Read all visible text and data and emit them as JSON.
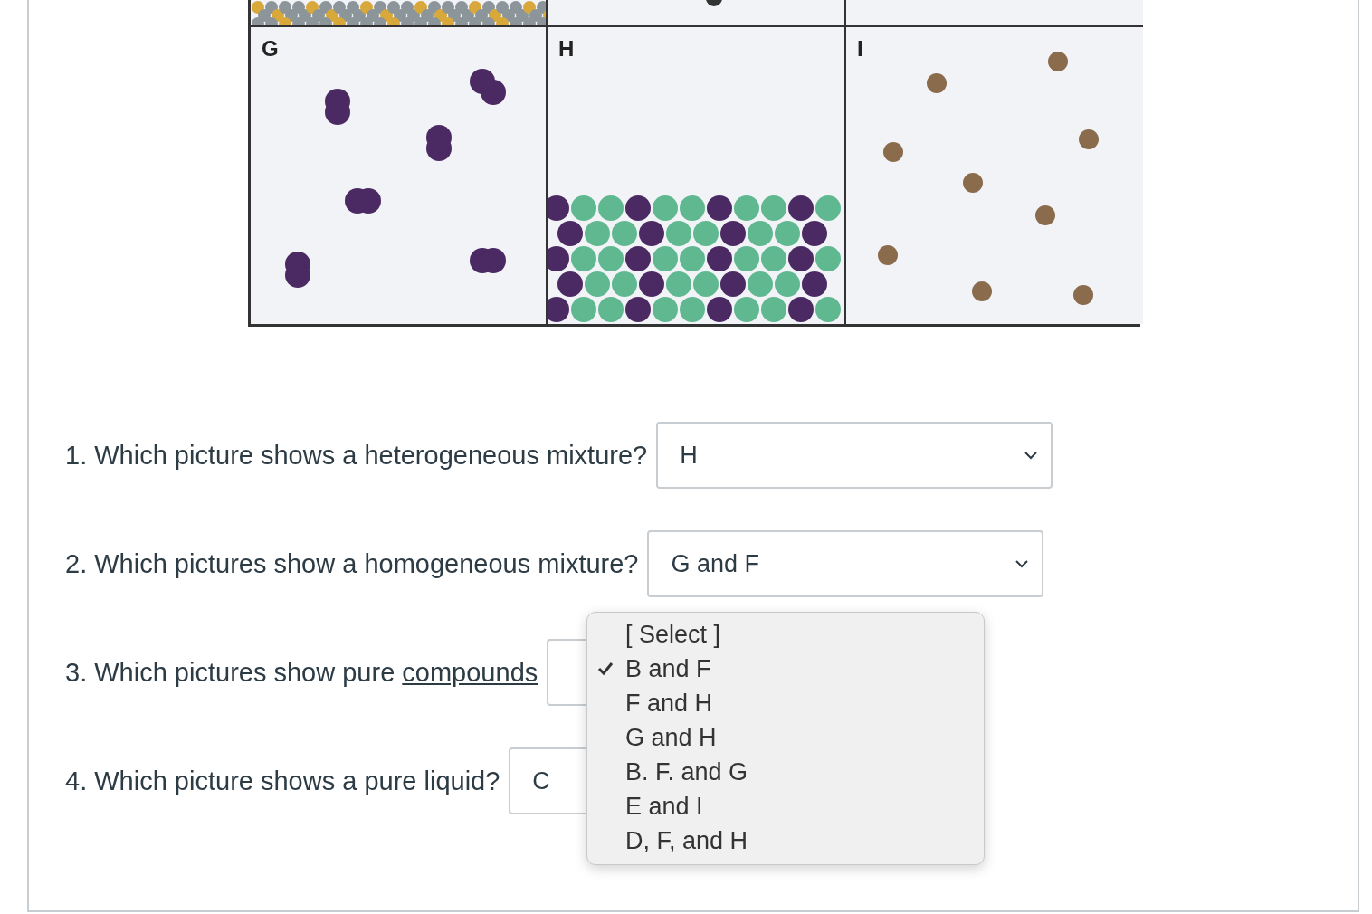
{
  "figure": {
    "panels": [
      {
        "kind": "packed-solid"
      },
      {
        "kind": "few-particles"
      },
      {
        "kind": "empty"
      },
      {
        "kind": "diatomic-gas",
        "label": "G"
      },
      {
        "kind": "mixed-solid",
        "label": "H"
      },
      {
        "kind": "monatomic-gas",
        "label": "I"
      }
    ]
  },
  "questions": [
    {
      "text": "1. Which picture shows a heterogeneous mixture?",
      "value": "H"
    },
    {
      "text": "2. Which pictures show a homogeneous mixture?",
      "value": "G and F"
    },
    {
      "text": "3. Which pictures show pure ",
      "link": "compounds"
    },
    {
      "text": "4. Which picture shows a pure liquid?",
      "value": "C"
    }
  ],
  "dropdown": {
    "options": [
      {
        "label": "[ Select ]",
        "selected": false
      },
      {
        "label": "B and F",
        "selected": true
      },
      {
        "label": "F and H",
        "selected": false
      },
      {
        "label": "G and H",
        "selected": false
      },
      {
        "label": "B. F. and G",
        "selected": false
      },
      {
        "label": "E and I",
        "selected": false
      },
      {
        "label": "D, F, and H",
        "selected": false
      }
    ]
  }
}
